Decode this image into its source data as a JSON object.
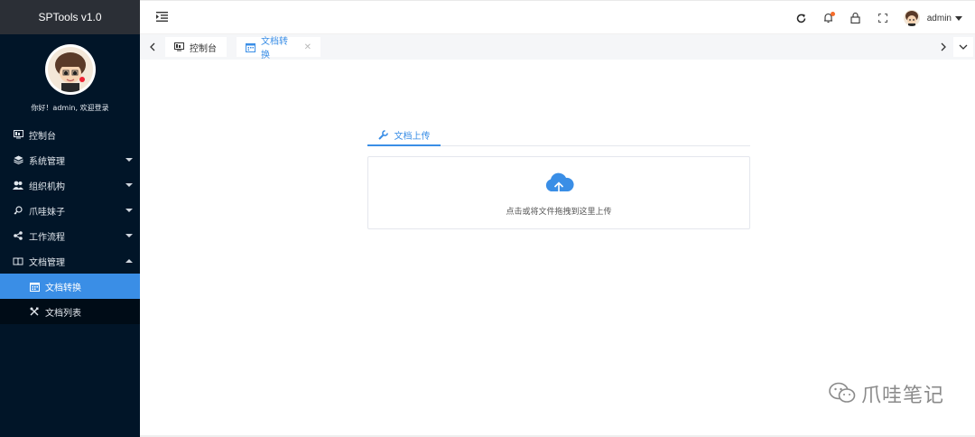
{
  "app": {
    "title": "SPTools v1.0"
  },
  "sidebar": {
    "greeting": "你好！admin, 欢迎登录",
    "items": [
      {
        "label": "控制台",
        "icon": "monitor-icon",
        "expandable": false
      },
      {
        "label": "系统管理",
        "icon": "layers-icon",
        "expandable": true
      },
      {
        "label": "组织机构",
        "icon": "users-icon",
        "expandable": true
      },
      {
        "label": "爪哇妹子",
        "icon": "key-icon",
        "expandable": true
      },
      {
        "label": "工作流程",
        "icon": "share-icon",
        "expandable": true
      },
      {
        "label": "文档管理",
        "icon": "books-icon",
        "expandable": true,
        "expanded": true,
        "children": [
          {
            "label": "文档转换",
            "icon": "calendar-icon",
            "active": true
          },
          {
            "label": "文档列表",
            "icon": "tools-icon",
            "active": false
          }
        ]
      }
    ],
    "colors": {
      "bg": "#011528",
      "active": "#3a8ee6",
      "brand_bg": "#2b2f36"
    }
  },
  "header": {
    "user": "admin",
    "icons": [
      "refresh-icon",
      "bell-icon",
      "lock-icon",
      "fullscreen-icon"
    ]
  },
  "tabs": [
    {
      "label": "控制台",
      "icon": "monitor-icon",
      "active": false
    },
    {
      "label": "文档转换",
      "icon": "calendar-icon",
      "active": true,
      "closable": true
    }
  ],
  "main": {
    "upload_tab": "文档上传",
    "dropzone_hint": "点击或将文件拖拽到这里上传"
  },
  "watermark": {
    "text": "爪哇笔记"
  }
}
